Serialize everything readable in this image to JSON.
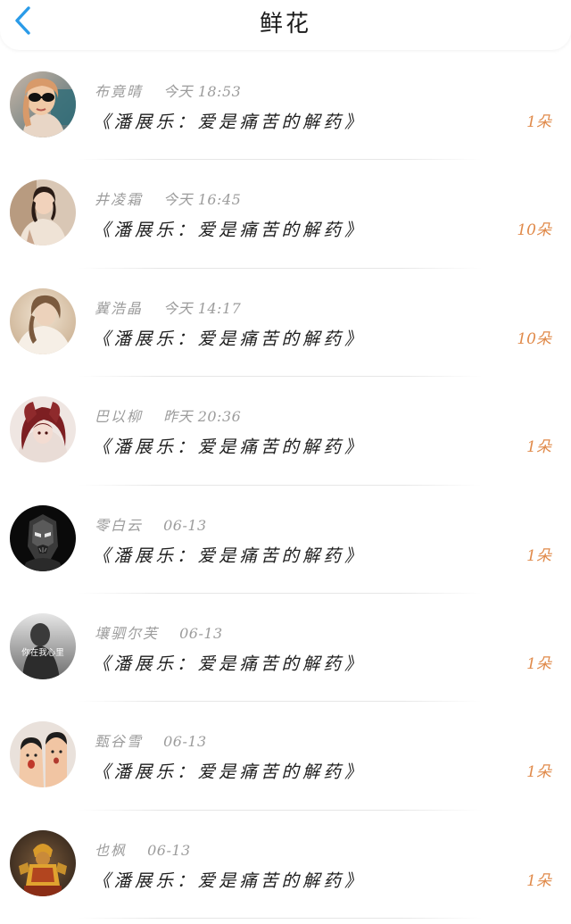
{
  "header": {
    "title": "鲜花",
    "back_icon": "chevron-left-icon",
    "accent_color": "#2a9be8"
  },
  "count_color": "#e08a4a",
  "items": [
    {
      "name": "布竟晴",
      "time": "今天 18:53",
      "work": "《潘展乐：爱是痛苦的解药》",
      "count": "1朵"
    },
    {
      "name": "井凌霜",
      "time": "今天 16:45",
      "work": "《潘展乐：爱是痛苦的解药》",
      "count": "10朵"
    },
    {
      "name": "冀浩晶",
      "time": "今天 14:17",
      "work": "《潘展乐：爱是痛苦的解药》",
      "count": "10朵"
    },
    {
      "name": "巴以柳",
      "time": "昨天 20:36",
      "work": "《潘展乐：爱是痛苦的解药》",
      "count": "1朵"
    },
    {
      "name": "零白云",
      "time": "06-13",
      "work": "《潘展乐：爱是痛苦的解药》",
      "count": "1朵"
    },
    {
      "name": "壤驷尔芙",
      "time": "06-13",
      "work": "《潘展乐：爱是痛苦的解药》",
      "count": "1朵",
      "avatar_text": "你在我心里"
    },
    {
      "name": "甄谷雪",
      "time": "06-13",
      "work": "《潘展乐：爱是痛苦的解药》",
      "count": "1朵"
    },
    {
      "name": "也枫",
      "time": "06-13",
      "work": "《潘展乐：爱是痛苦的解药》",
      "count": "1朵"
    }
  ]
}
